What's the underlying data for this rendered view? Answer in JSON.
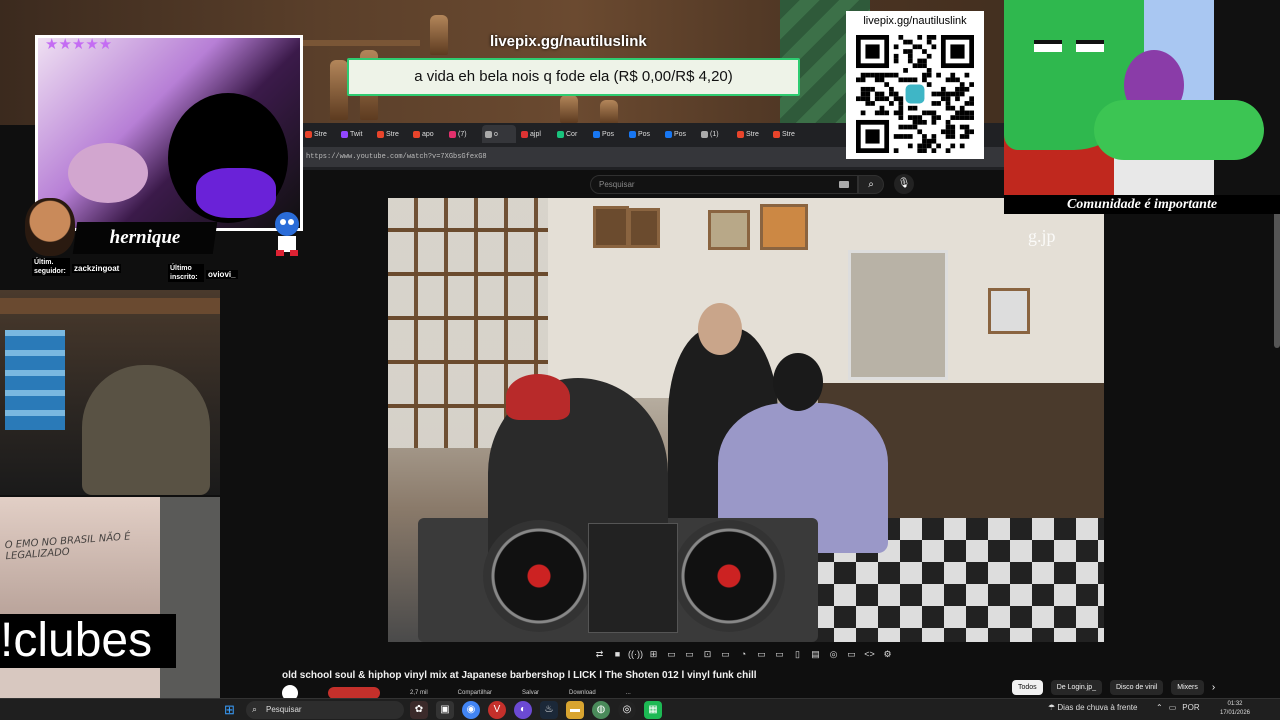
{
  "stream_overlay": {
    "rating_stars": "★★★★★",
    "streamer_name": "hernique",
    "last_follower_label": "Últim. seguidor:",
    "last_follower": "zackzingoat",
    "last_subscriber_label": "Último inscrito:",
    "last_subscriber": "oviovi_",
    "livepix_url_top": "livepix.gg/nautiluslink",
    "donation_message": "a vida eh bela nois q fode ela (R$ 0,00/R$ 4,20)",
    "qr_label": "livepix.gg/nautiluslink",
    "cartoon_caption": "Comunidade é importante",
    "command_label": "!clubes",
    "graffiti_text": "O EMO NO BRASIL NÃO É LEGALIZADO"
  },
  "browser": {
    "url": "https://www.youtube.com/watch?v=7XGbsGfexG8",
    "tabs": [
      {
        "label": "Stre",
        "color": "#e8442b"
      },
      {
        "label": "Twit",
        "color": "#9146ff"
      },
      {
        "label": "Stre",
        "color": "#e8442b"
      },
      {
        "label": "apo",
        "color": "#e8442b"
      },
      {
        "label": "(7)",
        "color": "#e1306c"
      },
      {
        "label": "o",
        "color": "#aaaaaa",
        "active": true
      },
      {
        "label": "ajpl",
        "color": "#d33"
      },
      {
        "label": "Cor",
        "color": "#19c37d"
      },
      {
        "label": "Pos",
        "color": "#1877f2"
      },
      {
        "label": "Pos",
        "color": "#1877f2"
      },
      {
        "label": "Pos",
        "color": "#1877f2"
      },
      {
        "label": "(1)",
        "color": "#aaaaaa"
      },
      {
        "label": "Stre",
        "color": "#e8442b"
      },
      {
        "label": "Stre",
        "color": "#e8442b"
      }
    ]
  },
  "youtube": {
    "search_placeholder": "Pesquisar",
    "video_watermark": "g.jp",
    "video_title": "old school soul & hiphop vinyl mix at Japanese barbershop l LICK l The Shoten 012 l vinyl funk chill",
    "under_row": [
      "2,7 mil",
      "Compartilhar",
      "Salvar",
      "Download",
      "..."
    ],
    "chips": [
      {
        "label": "Todos",
        "active": true
      },
      {
        "label": "De Login.jp_",
        "active": false
      },
      {
        "label": "Disco de vinil",
        "active": false
      },
      {
        "label": "Mixers",
        "active": false
      }
    ],
    "player_controls": [
      "⇄",
      "■",
      "((·))",
      "⊞",
      "▭",
      "▭",
      "⊡",
      "▭",
      "◔",
      "▭",
      "▭",
      "▯",
      "▤",
      "◎",
      "▭",
      "<>",
      "⚙"
    ]
  },
  "taskbar": {
    "search_placeholder": "Pesquisar",
    "weather": "Dias de chuva à frente",
    "language": "POR",
    "time": "01:32",
    "date": "17/01/2026"
  }
}
